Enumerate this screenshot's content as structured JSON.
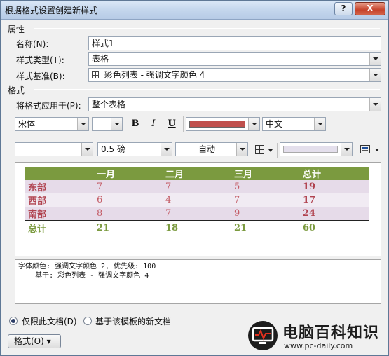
{
  "window": {
    "title": "根据格式设置创建新样式",
    "help": "?",
    "close": "X"
  },
  "properties": {
    "section_label": "属性",
    "name_label": "名称(N):",
    "name_value": "样式1",
    "type_label": "样式类型(T):",
    "type_value": "表格",
    "based_label": "样式基准(B):",
    "based_value": "彩色列表 - 强调文字颜色 4"
  },
  "format": {
    "section_label": "格式",
    "apply_label": "将格式应用于(P):",
    "apply_value": "整个表格",
    "font": "宋体",
    "size": "",
    "bold": "B",
    "italic": "I",
    "underline": "U",
    "font_color": "#c0504d",
    "language": "中文",
    "border_weight": "0.5 磅",
    "border_color": "自动",
    "shading_color": "#e4dfec"
  },
  "preview": {
    "headers": [
      "",
      "一月",
      "二月",
      "三月",
      "总计"
    ],
    "rows": [
      [
        "东部",
        "7",
        "7",
        "5",
        "19"
      ],
      [
        "西部",
        "6",
        "4",
        "7",
        "17"
      ],
      [
        "南部",
        "8",
        "7",
        "9",
        "24"
      ]
    ],
    "total_row": [
      "总计",
      "21",
      "18",
      "21",
      "60"
    ]
  },
  "description": {
    "line1": "字体颜色: 强调文字颜色 2, 优先级: 100",
    "line2": "    基于: 彩色列表 - 强调文字颜色 4"
  },
  "options": {
    "this_doc_only": "仅限此文档(D)",
    "template_docs": "基于该模板的新文档",
    "format_button": "格式(O) ▾"
  },
  "watermark": {
    "name": "电脑百科知识",
    "url": "www.pc-daily.com"
  },
  "colors": {
    "header_green": "#7b9a3f",
    "row_name_red": "#b0424f",
    "band": "#e6dbe9"
  }
}
